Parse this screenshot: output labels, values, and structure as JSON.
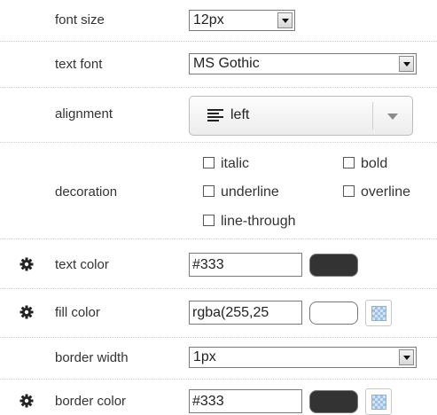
{
  "font_size": {
    "label": "font size",
    "value": "12px"
  },
  "text_font": {
    "label": "text font",
    "value": "MS Gothic"
  },
  "alignment": {
    "label": "alignment",
    "value": "left",
    "icon": "align-left-icon"
  },
  "decoration": {
    "label": "decoration",
    "options": {
      "italic": "italic",
      "bold": "bold",
      "underline": "underline",
      "overline": "overline",
      "line_through": "line-through"
    }
  },
  "text_color": {
    "label": "text color",
    "value": "#333",
    "swatch": "#333333"
  },
  "fill_color": {
    "label": "fill color",
    "value": "rgba(255,25",
    "swatch": "#ffffff"
  },
  "border_width": {
    "label": "border width",
    "value": "1px"
  },
  "border_color": {
    "label": "border color",
    "value": "#333",
    "swatch": "#333333"
  },
  "icons": {
    "gear": "gear-icon",
    "pattern": "pattern-icon"
  }
}
